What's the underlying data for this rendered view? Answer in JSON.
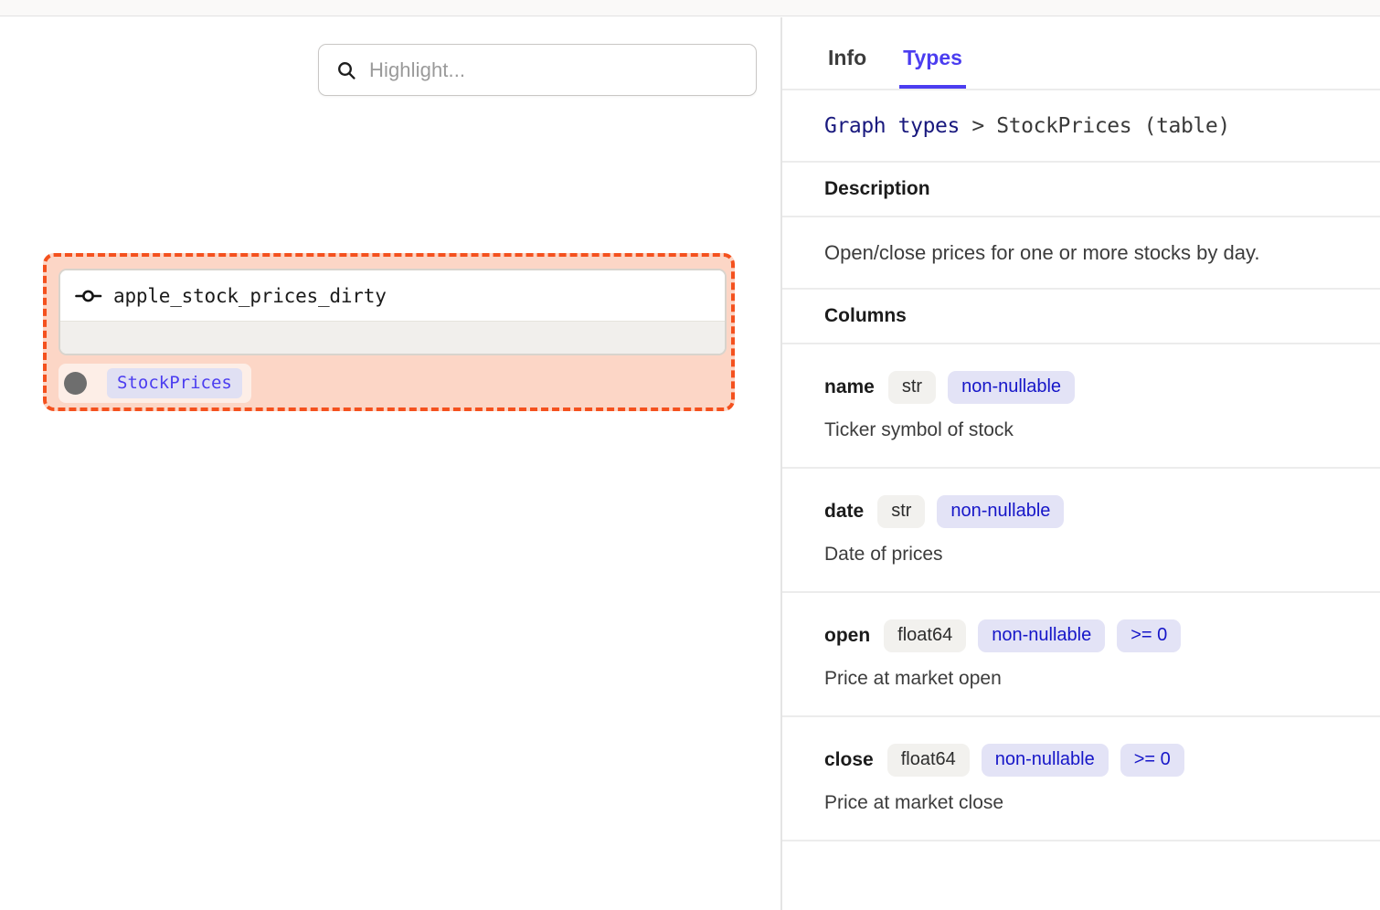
{
  "search": {
    "placeholder": "Highlight...",
    "value": "",
    "icon": "search-icon"
  },
  "graph": {
    "node": {
      "icon": "node-port-icon",
      "title": "apple_stock_prices_dirty",
      "dot_icon": "output-dot-icon",
      "type_chip": "StockPrices",
      "highlight_color": "#f4511e",
      "highlight_fill": "#fcd6c6"
    }
  },
  "details": {
    "tabs": [
      {
        "label": "Info",
        "active": false
      },
      {
        "label": "Types",
        "active": true
      }
    ],
    "breadcrumb": {
      "root": "Graph types",
      "separator": ">",
      "current": "StockPrices (table)"
    },
    "description_heading": "Description",
    "description_text": "Open/close prices for one or more stocks by day.",
    "columns_heading": "Columns",
    "columns": [
      {
        "name": "name",
        "dtype": "str",
        "nullability": "non-nullable",
        "constraint": "",
        "description": "Ticker symbol of stock"
      },
      {
        "name": "date",
        "dtype": "str",
        "nullability": "non-nullable",
        "constraint": "",
        "description": "Date of prices"
      },
      {
        "name": "open",
        "dtype": "float64",
        "nullability": "non-nullable",
        "constraint": ">= 0",
        "description": "Price at market open"
      },
      {
        "name": "close",
        "dtype": "float64",
        "nullability": "non-nullable",
        "constraint": ">= 0",
        "description": "Price at market close"
      }
    ]
  },
  "theme": {
    "accent": "#4b3df0",
    "link": "#19197e",
    "badge_text": "#1616c8",
    "highlight": "#f4511e"
  }
}
